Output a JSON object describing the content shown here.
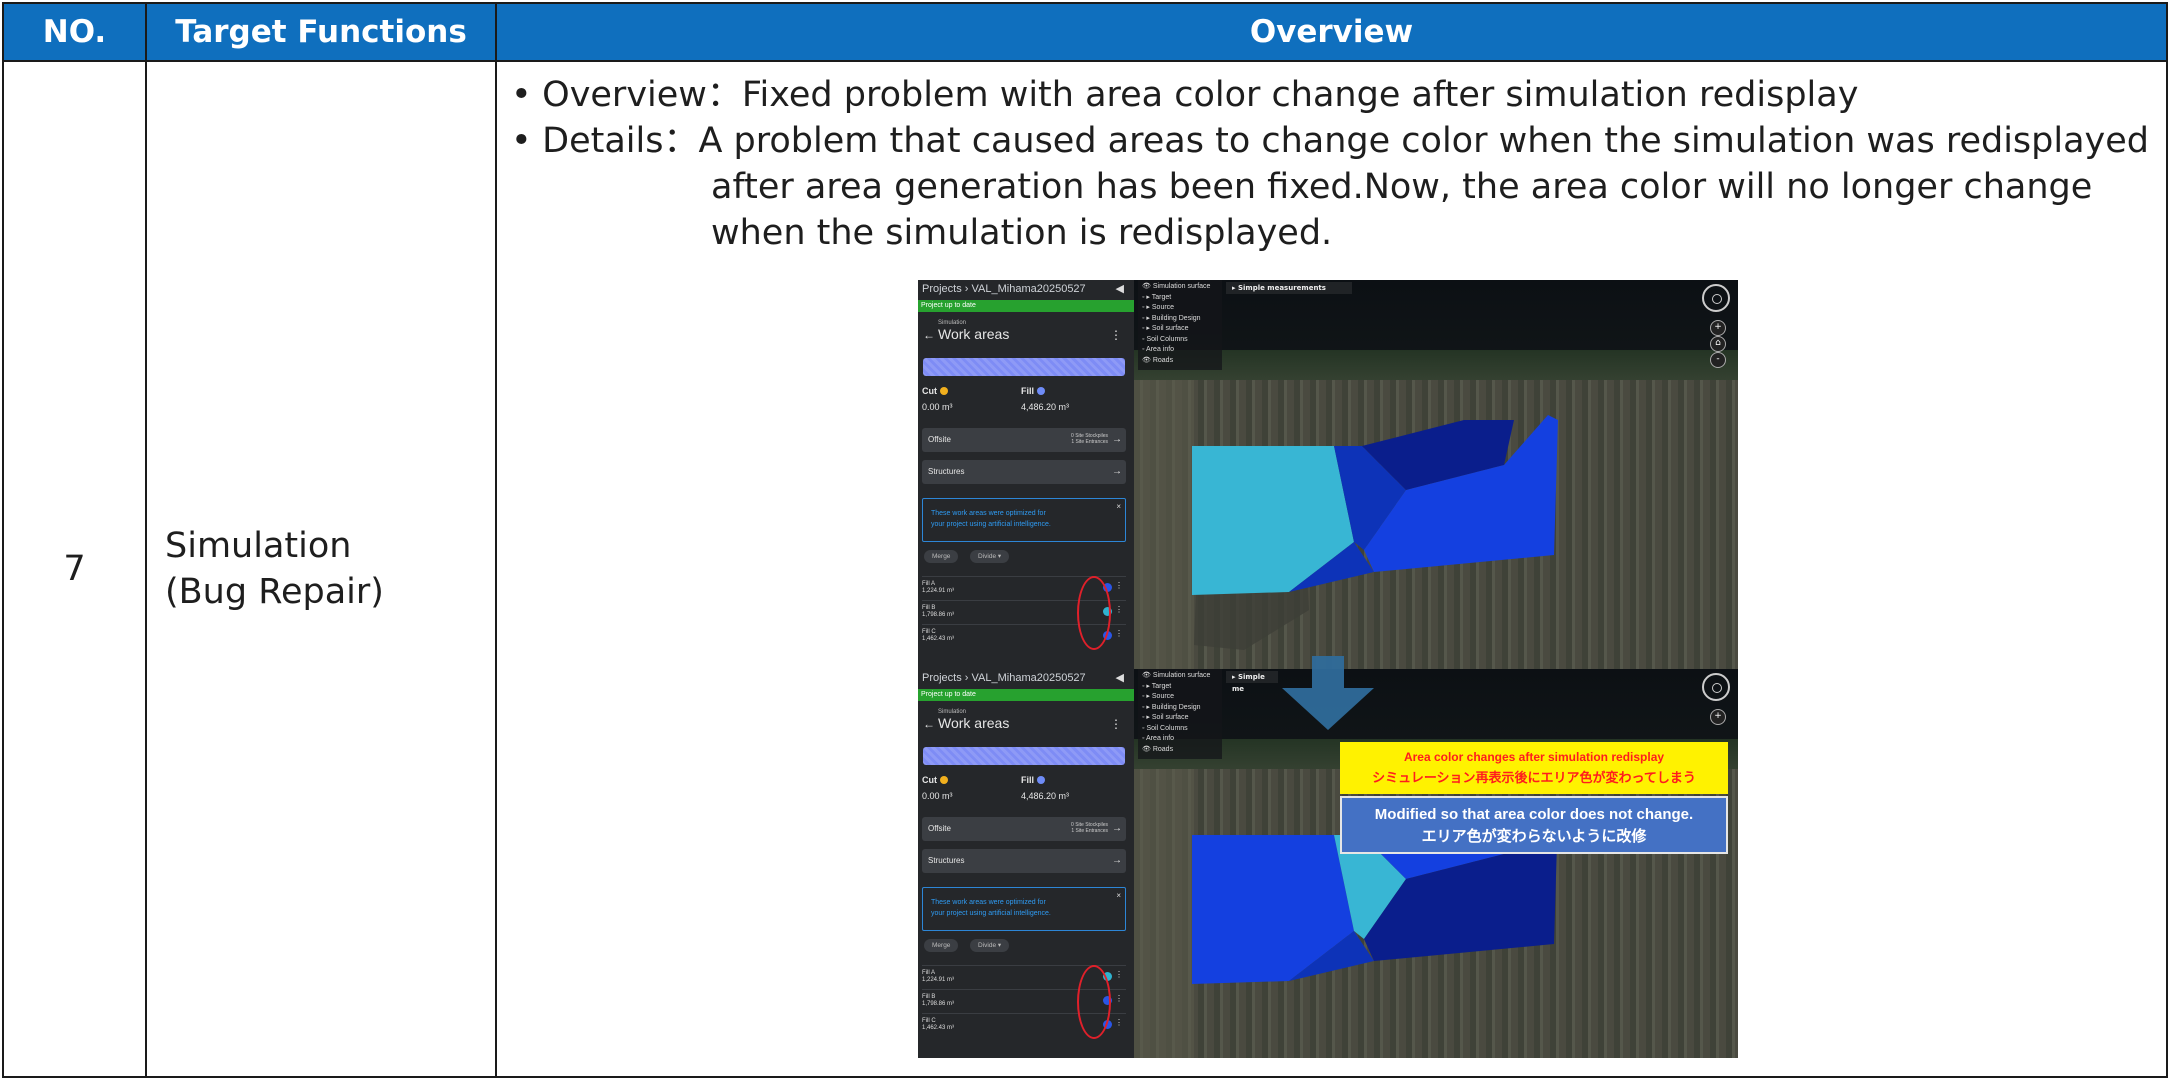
{
  "headers": {
    "no": "NO.",
    "functions": "Target Functions",
    "overview": "Overview"
  },
  "row": {
    "no": "7",
    "function_line1": "Simulation",
    "function_line2": "(Bug Repair)",
    "overview_label": "Overview：",
    "overview_text": "Fixed problem with area color change after simulation redisplay",
    "details_label": "Details：",
    "details_line1": "A problem that caused areas to change color when the simulation was redisplayed",
    "details_line2": "after area generation has been fixed.Now, the area color will no longer change",
    "details_line3": "when the simulation is redisplayed."
  },
  "screenshot": {
    "breadcrumb": "Projects › VAL_Mihama20250527",
    "status": "Project up to date",
    "section_small": "Simulation",
    "section_title": "Work areas",
    "cut_label": "Cut",
    "fill_label": "Fill",
    "cut_value": "0.00 m³",
    "fill_value": "4,486.20 m³",
    "offsite_label": "Offsite",
    "offsite_detail1": "0 Site Stockpiles",
    "offsite_detail2": "1 Site Entrances",
    "structures_label": "Structures",
    "ai_note_line1": "These work areas were optimized for",
    "ai_note_line2": "your project using artificial intelligence.",
    "merge_label": "Merge",
    "divide_label": "Divide ▾",
    "items": [
      {
        "name": "Fill A",
        "value": "1,224.91 m³"
      },
      {
        "name": "Fill B",
        "value": "1,798.86 m³"
      },
      {
        "name": "Fill C",
        "value": "1,462.43 m³"
      }
    ],
    "layers": [
      "Simulation surface",
      "Target",
      "Source",
      "Building Design",
      "Soil surface",
      "Soil Columns",
      "Area info",
      "Roads"
    ],
    "measure_top": "Simple measurements",
    "measure_bottom": "Simple me",
    "callout_before_en": "Area color changes after simulation redisplay",
    "callout_before_ja": "シミュレーション再表示後にエリア色が変わってしまう",
    "callout_after_en": "Modified so that area color does not change.",
    "callout_after_ja": "エリア色が変わらないように改修",
    "colors": {
      "header_blue": "#0f6fbe",
      "area_light": "#38b6d4",
      "area_mid": "#0d33b8",
      "area_dark": "#0a1e8c",
      "callout_yellow": "#fff200",
      "callout_blue": "#4471c4",
      "ring_red": "#e0202a"
    }
  }
}
